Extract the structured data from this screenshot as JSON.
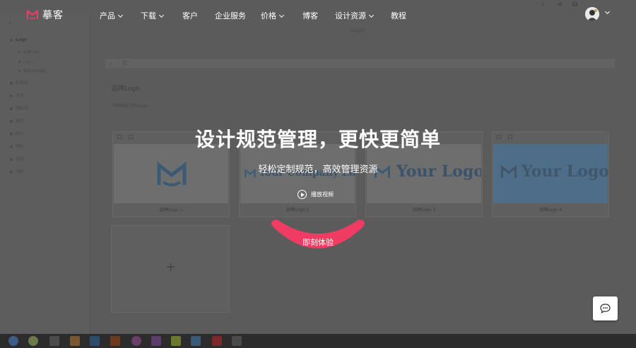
{
  "nav": {
    "brand": "摹客",
    "items": [
      {
        "label": "产品",
        "dropdown": true
      },
      {
        "label": "下载",
        "dropdown": true
      },
      {
        "label": "客户",
        "dropdown": false
      },
      {
        "label": "企业服务",
        "dropdown": false
      },
      {
        "label": "价格",
        "dropdown": true
      },
      {
        "label": "博客",
        "dropdown": false
      },
      {
        "label": "设计资源",
        "dropdown": true
      },
      {
        "label": "教程",
        "dropdown": false
      }
    ]
  },
  "hero": {
    "title": "设计规范管理，更快更简单",
    "subtitle": "轻松定制规范，高效管理资源",
    "video_label": "播放视频",
    "cta_label": "即刻体验"
  },
  "background": {
    "page_title": "Logo",
    "sidebar": {
      "items": [
        "Logo",
        "品牌Logo",
        "Logo 2",
        "等比Logo缩放",
        "标准色",
        "字体",
        "图标库",
        "按钮",
        "图片",
        "图标",
        "布局",
        "间距"
      ]
    },
    "section_title": "品牌Logo",
    "section_desc": "不同场景下的Logo。",
    "cards": [
      {
        "caption": "品牌Logo 1",
        "logo_text": ""
      },
      {
        "caption": "品牌Logo 2",
        "logo_text": "Your Company Logo"
      },
      {
        "caption": "品牌Logo 3",
        "logo_text": "Your Logo"
      },
      {
        "caption": "品牌Logo 4",
        "logo_text": "Your Logo"
      }
    ]
  },
  "colors": {
    "accent": "#f03b62",
    "overlay": "#5b5b5b",
    "brand_icon": "#f03b62"
  },
  "icons": {
    "play": "play-circle-icon",
    "chat": "chat-bubble-icon",
    "brand": "mockplus-logo-icon"
  }
}
